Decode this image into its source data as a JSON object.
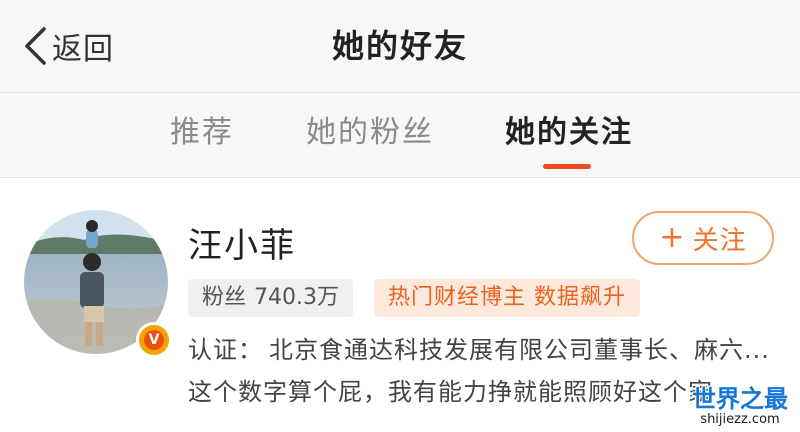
{
  "header": {
    "back_label": "返回",
    "title": "她的好友"
  },
  "tabs": [
    {
      "label": "推荐",
      "active": false
    },
    {
      "label": "她的粉丝",
      "active": false
    },
    {
      "label": "她的关注",
      "active": true
    }
  ],
  "user": {
    "name": "汪小菲",
    "fans_label": "粉丝",
    "fans_count": "740.3万",
    "hot_tag": "热门财经博主 数据飙升",
    "verify_label": "认证：",
    "verify_text": "北京食通达科技发展有限公司董事长、麻六...",
    "bio": "这个数字算个屁，我有能力挣就能照顾好这个家",
    "verified_badge": "V"
  },
  "follow_button": {
    "plus": "+",
    "label": "关注"
  },
  "watermark": {
    "main": "世界之最",
    "sub": "shijiezz.com"
  },
  "colors": {
    "accent": "#f04a1f",
    "follow": "#f07328",
    "hot_tag_text": "#e8641f",
    "watermark": "#1477d9"
  }
}
